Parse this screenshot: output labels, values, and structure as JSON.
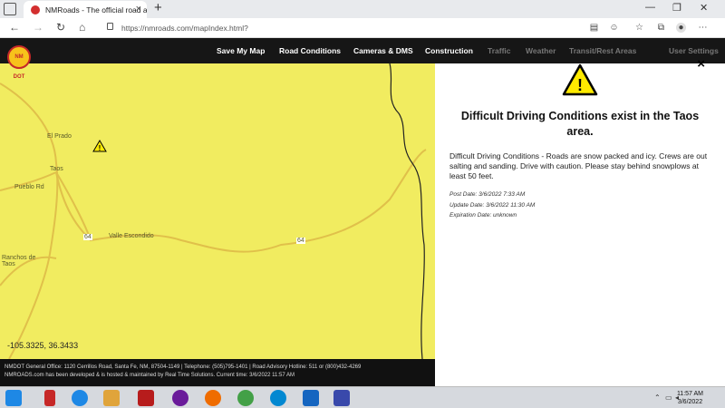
{
  "browser": {
    "tab_title": "NMRoads - The official road adv",
    "url": "https://nmroads.com/mapIndex.html?"
  },
  "navbar": {
    "logo": "NM DOT",
    "items": [
      "Save My Map",
      "Road Conditions",
      "Cameras & DMS",
      "Construction",
      "Traffic",
      "Weather",
      "Transit/Rest Areas",
      "User Settings"
    ]
  },
  "map": {
    "labels": [
      "El Prado",
      "Taos",
      "Ranchos de Taos",
      "Pueblo Rd",
      "Valle Escondido"
    ],
    "road_shields": [
      "64",
      "64"
    ],
    "coordinates": "-105.3325, 36.3433",
    "highlight_color": "#f1ec60"
  },
  "alert": {
    "close": "×",
    "title": "Difficult Driving Conditions exist in the Taos area.",
    "description": "Difficult Driving Conditions - Roads are snow packed and icy. Crews are out salting and sanding. Drive with caution. Please stay behind snowplows at least 50 feet.",
    "post_date": "Post Date: 3/6/2022 7:33 AM",
    "update_date": "Update Date: 3/6/2022 11:30 AM",
    "expiration": "Expiration Date: unknown"
  },
  "footer": {
    "line1": "NMDOT General Office: 1120 Cerrillos Road, Santa Fe, NM, 87504-1149 | Telephone: (505)795-1401 | Road Advisory Hotline: 511 or (800)432-4269",
    "line2": "NMROADS.com has been developed & is hosted & maintained by Real Time Solutions. Current time: 3/6/2022 11:57 AM"
  },
  "taskbar": {
    "time": "11:57 AM",
    "date": "3/6/2022"
  }
}
